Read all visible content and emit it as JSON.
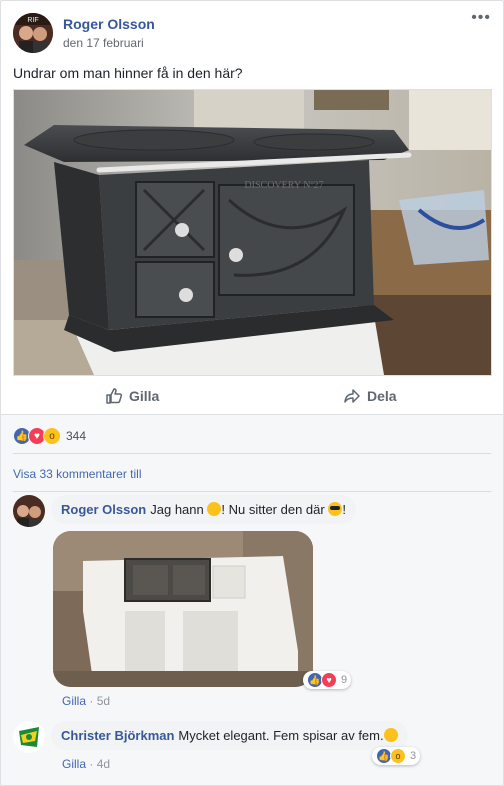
{
  "post": {
    "author": "Roger Olsson",
    "date": "den 17 februari",
    "more_icon": "•••",
    "text": "Undrar om man hinner få in den här?",
    "actions": {
      "like_label": "Gilla",
      "share_label": "Dela"
    }
  },
  "reactions": {
    "count": "344",
    "types": [
      "like",
      "love",
      "wow"
    ]
  },
  "view_more": "Visa 33 kommentarer till",
  "comments": [
    {
      "author": "Roger Olsson",
      "text_part1": "Jag hann",
      "text_part2": "! Nu sitter den där",
      "text_part3": "!",
      "like_label": "Gilla",
      "time": "5d",
      "reaction_count": "9"
    },
    {
      "author": "Christer Björkman",
      "text": "Mycket elegant. Fem spisar av fem.",
      "like_label": "Gilla",
      "time": "4d",
      "reaction_count": "3"
    }
  ],
  "colors": {
    "link": "#365899",
    "like_blue": "#4267b2",
    "love_red": "#f33e58",
    "wow_yellow": "#fcc21b"
  }
}
